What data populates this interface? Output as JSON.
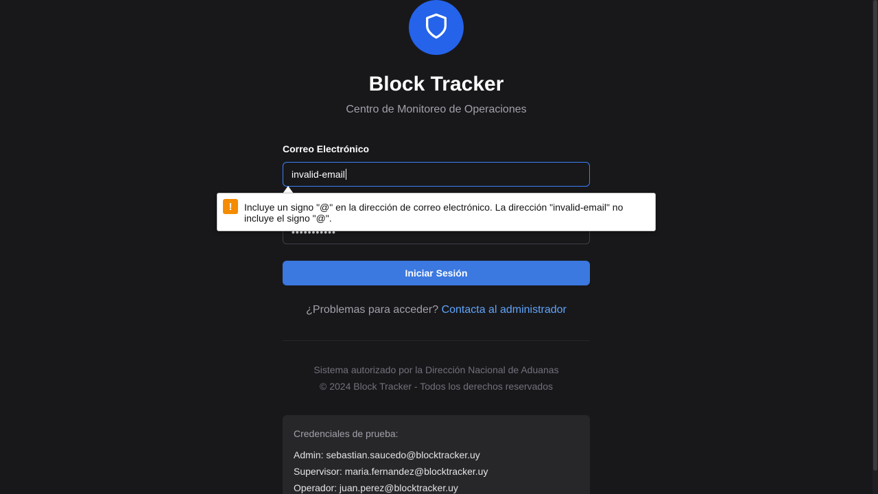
{
  "app": {
    "title": "Block Tracker",
    "subtitle": "Centro de Monitoreo de Operaciones",
    "logo_icon": "shield-icon",
    "brand_color": "#2563eb"
  },
  "form": {
    "email_label": "Correo Electrónico",
    "email_value": "invalid-email",
    "password_masked": "•••••••••••",
    "submit_label": "Iniciar Sesión"
  },
  "validation_tooltip": {
    "icon": "warning-icon",
    "message": "Incluye un signo \"@\" en la dirección de correo electrónico. La dirección \"invalid-email\" no incluye el signo \"@\"."
  },
  "help": {
    "text": "¿Problemas para acceder?",
    "link_label": "Contacta al administrador"
  },
  "footer": {
    "line1": "Sistema autorizado por la Dirección Nacional de Aduanas",
    "line2": "© 2024 Block Tracker - Todos los derechos reservados"
  },
  "test_credentials": {
    "title": "Credenciales de prueba:",
    "lines": [
      "Admin: sebastian.saucedo@blocktracker.uy",
      "Supervisor: maria.fernandez@blocktracker.uy",
      "Operador: juan.perez@blocktracker.uy"
    ]
  }
}
